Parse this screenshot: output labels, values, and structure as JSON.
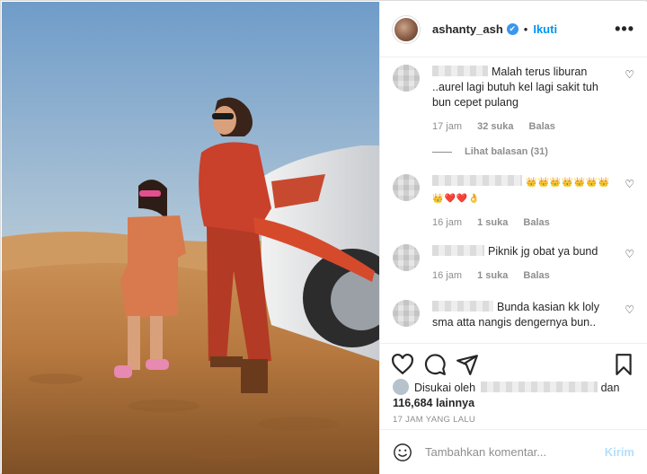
{
  "post": {
    "username": "ashanty_ash",
    "verified_mark": "✔",
    "separator": "•",
    "follow_label": "Ikuti",
    "more_label": "•••"
  },
  "comments": [
    {
      "text": "Malah terus liburan ..aurel lagi butuh kel lagi sakit tuh bun cepet pulang",
      "time": "17 jam",
      "likes": "32 suka",
      "reply_label": "Balas",
      "view_replies": "Lihat balasan (31)"
    },
    {
      "text": "👑👑👑👑👑👑👑👑❤️❤️👌",
      "time": "16 jam",
      "likes": "1 suka",
      "reply_label": "Balas"
    },
    {
      "text": "Piknik jg obat ya bund",
      "time": "16 jam",
      "likes": "1 suka",
      "reply_label": "Balas"
    },
    {
      "text": "Bunda kasian kk loly sma atta nangis dengernya bun..",
      "time": "",
      "likes": "",
      "reply_label": ""
    }
  ],
  "likes": {
    "prefix": "Disukai oleh",
    "joiner": "dan",
    "count": "116,684 lainnya"
  },
  "time_ago": "17 JAM YANG LALU",
  "add_comment": {
    "placeholder": "Tambahkan komentar...",
    "post_label": "Kirim"
  },
  "icons": [
    "heart-icon",
    "comment-icon",
    "share-icon",
    "bookmark-icon",
    "smile-icon",
    "verified-badge-icon",
    "more-options-icon"
  ],
  "colors": {
    "accent": "#0095f6",
    "verified": "#3897f0",
    "muted": "#8e8e8e",
    "post_disabled": "#b2dffc"
  }
}
